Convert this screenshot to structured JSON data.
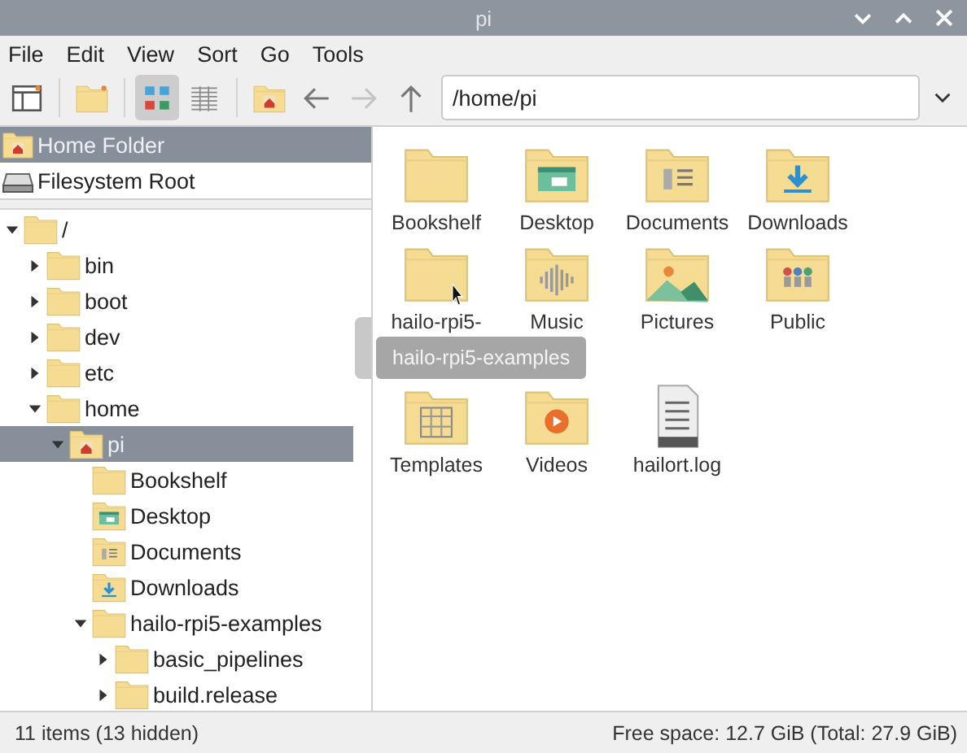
{
  "window": {
    "title": "pi"
  },
  "menu": [
    "File",
    "Edit",
    "View",
    "Sort",
    "Go",
    "Tools"
  ],
  "toolbar": {
    "buttons": [
      {
        "kind": "pane",
        "selected": false,
        "disabled": false
      },
      {
        "kind": "newfolder",
        "selected": false,
        "disabled": false
      },
      {
        "kind": "iconview",
        "selected": true,
        "disabled": false
      },
      {
        "kind": "listview",
        "selected": false,
        "disabled": false
      },
      {
        "kind": "home",
        "selected": false,
        "disabled": false
      },
      {
        "kind": "back",
        "selected": false,
        "disabled": false
      },
      {
        "kind": "forward",
        "selected": false,
        "disabled": true
      },
      {
        "kind": "up",
        "selected": false,
        "disabled": false
      }
    ],
    "path": "/home/pi"
  },
  "places": [
    {
      "label": "Home Folder",
      "kind": "home",
      "selected": true
    },
    {
      "label": "Filesystem Root",
      "kind": "drive",
      "selected": false
    }
  ],
  "tree": [
    {
      "label": "/",
      "kind": "folder",
      "expanded": true,
      "selected": false,
      "children": [
        {
          "label": "bin",
          "kind": "folder",
          "expanded": false,
          "selected": false
        },
        {
          "label": "boot",
          "kind": "folder",
          "expanded": false,
          "selected": false
        },
        {
          "label": "dev",
          "kind": "folder",
          "expanded": false,
          "selected": false
        },
        {
          "label": "etc",
          "kind": "folder",
          "expanded": false,
          "selected": false
        },
        {
          "label": "home",
          "kind": "folder",
          "expanded": true,
          "selected": false,
          "children": [
            {
              "label": "pi",
              "kind": "home",
              "expanded": true,
              "selected": true,
              "children": [
                {
                  "label": "Bookshelf",
                  "kind": "folder",
                  "selected": false
                },
                {
                  "label": "Desktop",
                  "kind": "desktop",
                  "selected": false
                },
                {
                  "label": "Documents",
                  "kind": "documents",
                  "selected": false
                },
                {
                  "label": "Downloads",
                  "kind": "downloads",
                  "selected": false
                },
                {
                  "label": "hailo-rpi5-examples",
                  "kind": "folder",
                  "expanded": true,
                  "selected": false,
                  "children": [
                    {
                      "label": "basic_pipelines",
                      "kind": "folder",
                      "expanded": false,
                      "selected": false
                    },
                    {
                      "label": "build.release",
                      "kind": "folder",
                      "expanded": false,
                      "selected": false
                    }
                  ]
                }
              ]
            }
          ]
        }
      ]
    }
  ],
  "files": [
    {
      "label": "Bookshelf",
      "kind": "folder"
    },
    {
      "label": "Desktop",
      "kind": "desktop"
    },
    {
      "label": "Documents",
      "kind": "documents"
    },
    {
      "label": "Downloads",
      "kind": "downloads"
    },
    {
      "label": "hailo-rpi5-",
      "kind": "folder"
    },
    {
      "label": "Music",
      "kind": "music"
    },
    {
      "label": "Pictures",
      "kind": "pictures"
    },
    {
      "label": "Public",
      "kind": "public"
    },
    {
      "label": "Templates",
      "kind": "templates"
    },
    {
      "label": "Videos",
      "kind": "videos"
    },
    {
      "label": "hailort.log",
      "kind": "text"
    }
  ],
  "tooltip": "hailo-rpi5-examples",
  "status_bar": {
    "items": "11 items (13 hidden)",
    "free_space": "Free space: 12.7 GiB (Total: 27.9 GiB)"
  }
}
